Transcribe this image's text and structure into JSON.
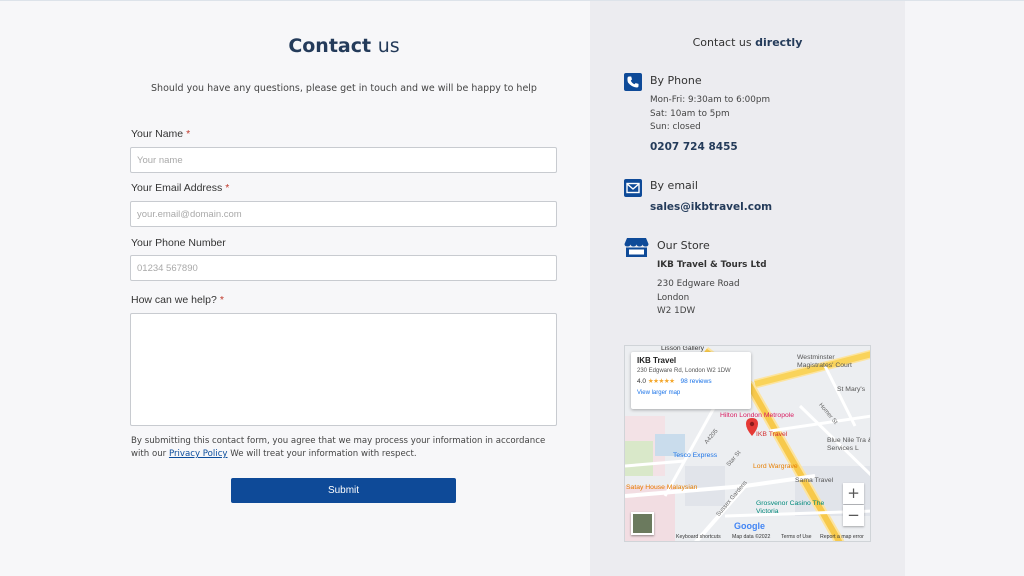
{
  "form": {
    "title_bold": "Contact",
    "title_rest": "us",
    "subtitle": "Should you have any questions, please get in touch and we will be happy to help",
    "name_label": "Your Name",
    "name_placeholder": "Your name",
    "email_label": "Your Email Address",
    "email_placeholder": "your.email@domain.com",
    "phone_label": "Your Phone Number",
    "phone_placeholder": "01234 567890",
    "help_label": "How can we help?",
    "required_mark": "*",
    "consent_before": "By submitting this contact form, you agree that we may process your information in accordance with our",
    "privacy_link": "Privacy Policy",
    "consent_after": "We will treat your information with respect.",
    "submit_label": "Submit"
  },
  "contact": {
    "title_prefix": "Contact us",
    "title_bold": "directly",
    "phone_heading": "By Phone",
    "hours": [
      "Mon-Fri: 9:30am to 6:00pm",
      "Sat: 10am to 5pm",
      "Sun: closed"
    ],
    "phone_number": "0207 724 8455",
    "email_heading": "By email",
    "email_address": "sales@ikbtravel.com",
    "store_heading": "Our Store",
    "store_name": "IKB Travel & Tours Ltd",
    "address": [
      "230 Edgware Road",
      "London",
      "W2 1DW"
    ]
  },
  "map": {
    "card_title": "IKB Travel",
    "card_address": "230 Edgware Rd, London W2 1DW",
    "rating": "4.0",
    "stars": "★★★★★",
    "reviews": "98 reviews",
    "larger_map": "View larger map",
    "labels": {
      "lisson": "Lisson Gallery",
      "westminster": "Westminster Magistrates' Court",
      "st_marys": "St Mary's",
      "hilton": "Hilton London Metropole",
      "ikb": "IKB Travel",
      "blue_nile": "Blue Nile Tra & Services L",
      "tesco": "Tesco Express",
      "lord_wargrave": "Lord Wargrave",
      "sama": "Sama Travel",
      "satay": "Satay House Malaysian",
      "grosvenor": "Grosvenor Casino The Victoria",
      "sussex": "Sussex Gardens",
      "star_st": "Star St",
      "a4205": "A4205",
      "homer_st": "Homer St"
    },
    "zoom_in": "+",
    "zoom_out": "−",
    "google": "Google",
    "footer": [
      "Keyboard shortcuts",
      "Map data ©2022",
      "Terms of Use",
      "Report a map error"
    ]
  },
  "colors": {
    "primary": "#0e4a98",
    "heading": "#243b5a",
    "required": "#c0392b"
  },
  "icons": {
    "phone": "phone-icon",
    "email": "envelope-icon",
    "store": "store-icon"
  }
}
